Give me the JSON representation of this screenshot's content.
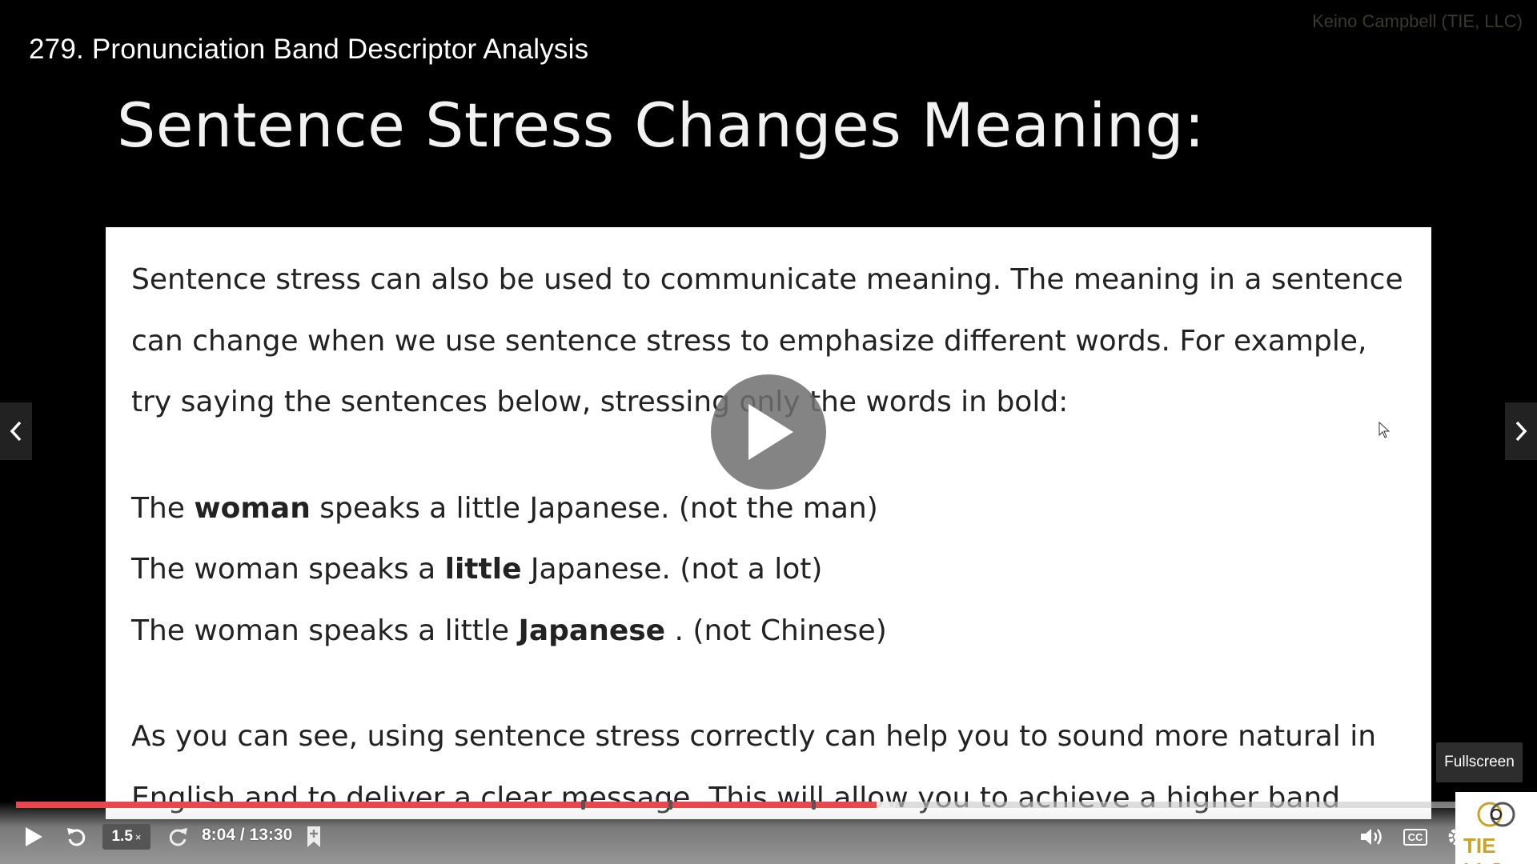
{
  "watermark": "Keino Campbell (TIE, LLC)",
  "video_title": "279. Pronunciation Band Descriptor Analysis",
  "slide": {
    "heading": "Sentence Stress Changes Meaning:",
    "intro": "Sentence stress can also be used to communicate meaning. The meaning in a sentence can change when we use sentence stress to emphasize different words. For example, try saying the sentences below, stressing only the words in bold:",
    "examples": [
      {
        "before": "The ",
        "bold": "woman",
        "after": " speaks a little Japanese. (not the man)"
      },
      {
        "before": "The woman speaks a ",
        "bold": "little",
        "after": " Japanese. (not a lot)"
      },
      {
        "before": "The woman speaks a little ",
        "bold": "Japanese",
        "after": " . (not Chinese)"
      }
    ],
    "conclusion": "As you can see, using sentence stress correctly can help you to sound more natural in English and to deliver a clear message. This will allow you to achieve a higher band score on your IELTS Speaking test."
  },
  "overlay": {
    "play_icon": "play-icon"
  },
  "tooltip": "Fullscreen",
  "controls": {
    "play_icon": "play-icon",
    "rewind_icon": "rewind-icon",
    "speed_value": "1.5",
    "speed_suffix": "×",
    "forward_icon": "forward-icon",
    "time": "8:04 / 13:30",
    "bookmark_icon": "bookmark-icon",
    "volume_icon": "volume-icon",
    "cc_label": "CC",
    "settings_icon": "gear-icon"
  },
  "progress": {
    "played_fraction": 0.597,
    "buffered_fraction": 0.61,
    "chapter_marker_fractions": [
      0.392,
      0.453,
      0.552
    ]
  },
  "logo": {
    "text": "TIE LLC"
  },
  "colors": {
    "progress_played": "#e5484d",
    "background": "#000000",
    "slide_background": "#ffffff",
    "logo_gold": "#c9a227"
  }
}
